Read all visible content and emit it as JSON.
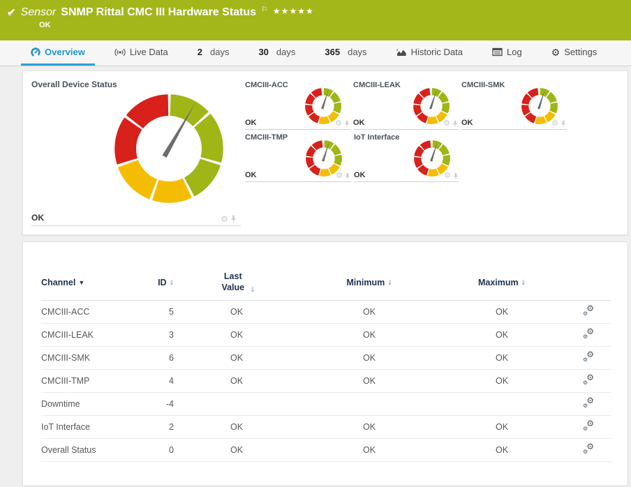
{
  "colors": {
    "green": "#9fb616",
    "yellow": "#f5bd02",
    "red": "#d8211a",
    "needle": "#6d6d6d",
    "accent_blue": "#2e9fd4",
    "header_green": "#a3b71a"
  },
  "header": {
    "check_icon": "✔",
    "kind": "Sensor",
    "title": "SNMP Rittal CMC III Hardware Status",
    "flag_icon": "⚐",
    "stars": "★★★★★",
    "status": "OK"
  },
  "tabs": {
    "overview": {
      "label": "Overview"
    },
    "live": {
      "label": "Live Data"
    },
    "d2": {
      "num": "2",
      "unit": "days"
    },
    "d30": {
      "num": "30",
      "unit": "days"
    },
    "d365": {
      "num": "365",
      "unit": "days"
    },
    "historic": {
      "label": "Historic Data"
    },
    "log": {
      "label": "Log"
    },
    "settings": {
      "label": "Settings",
      "gear": "⚙"
    }
  },
  "overview_panel": {
    "main_gauge": {
      "title": "Overall Device Status",
      "status": "OK",
      "needle_deg": 30,
      "segments": [
        [
          2,
          47,
          "green"
        ],
        [
          50,
          105,
          "green"
        ],
        [
          108,
          152,
          "green"
        ],
        [
          155,
          198,
          "yellow"
        ],
        [
          201,
          250,
          "yellow"
        ],
        [
          253,
          305,
          "red"
        ],
        [
          308,
          359,
          "red"
        ]
      ]
    },
    "mini_needle_deg": 18,
    "mini_segments": [
      [
        2,
        34,
        "green"
      ],
      [
        38,
        74,
        "green"
      ],
      [
        78,
        114,
        "green"
      ],
      [
        118,
        154,
        "yellow"
      ],
      [
        158,
        194,
        "yellow"
      ],
      [
        198,
        234,
        "red"
      ],
      [
        238,
        274,
        "red"
      ],
      [
        278,
        314,
        "red"
      ],
      [
        318,
        354,
        "red"
      ]
    ],
    "minis": [
      {
        "title": "CMCIII-ACC",
        "status": "OK"
      },
      {
        "title": "CMCIII-LEAK",
        "status": "OK"
      },
      {
        "title": "CMCIII-SMK",
        "status": "OK"
      },
      {
        "title": "CMCIII-TMP",
        "status": "OK"
      },
      {
        "title": "IoT Interface",
        "status": "OK"
      }
    ],
    "gear_icon": "⚙"
  },
  "table": {
    "headers": {
      "channel": "Channel",
      "id": "ID",
      "last": "Last Value",
      "min": "Minimum",
      "max": "Maximum"
    },
    "sorted_caret": "▼",
    "caret_up": "▲",
    "caret_down": "▼",
    "gear_glyph": "⚙",
    "rows": [
      {
        "channel": "CMCIII-ACC",
        "id": "5",
        "last": "OK",
        "min": "OK",
        "max": "OK"
      },
      {
        "channel": "CMCIII-LEAK",
        "id": "3",
        "last": "OK",
        "min": "OK",
        "max": "OK"
      },
      {
        "channel": "CMCIII-SMK",
        "id": "6",
        "last": "OK",
        "min": "OK",
        "max": "OK"
      },
      {
        "channel": "CMCIII-TMP",
        "id": "4",
        "last": "OK",
        "min": "OK",
        "max": "OK"
      },
      {
        "channel": "Downtime",
        "id": "-4",
        "last": "",
        "min": "",
        "max": ""
      },
      {
        "channel": "IoT Interface",
        "id": "2",
        "last": "OK",
        "min": "OK",
        "max": "OK"
      },
      {
        "channel": "Overall Status",
        "id": "0",
        "last": "OK",
        "min": "OK",
        "max": "OK"
      }
    ]
  }
}
